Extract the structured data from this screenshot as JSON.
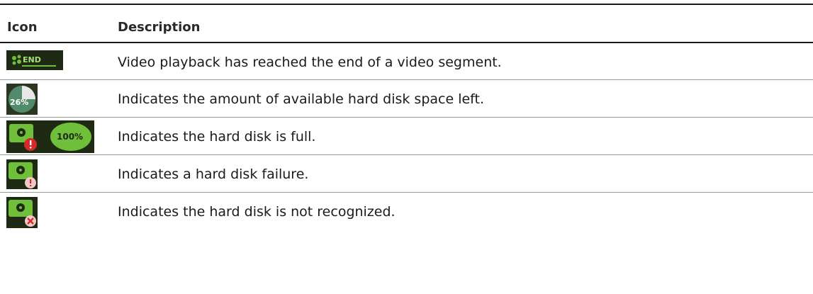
{
  "table": {
    "headers": {
      "icon": "Icon",
      "description": "Description"
    },
    "rows": [
      {
        "icon_name": "video-end-icon",
        "icon_text": "END",
        "description": "Video playback has reached the end of a video segment."
      },
      {
        "icon_name": "disk-space-pie-icon",
        "icon_text": "26%",
        "description": "Indicates the amount of available hard disk space left."
      },
      {
        "icon_name": "disk-full-icon",
        "icon_text": "100%",
        "description": "Indicates the hard disk is full."
      },
      {
        "icon_name": "disk-failure-icon",
        "icon_text": "",
        "description": "Indicates a hard disk failure."
      },
      {
        "icon_name": "disk-not-recognized-icon",
        "icon_text": "",
        "description": "Indicates the hard disk is not recognized."
      }
    ]
  },
  "colors": {
    "icon_bg": "#1f2a14",
    "icon_green": "#6fbf3a",
    "alert_red": "#d42a2a"
  }
}
